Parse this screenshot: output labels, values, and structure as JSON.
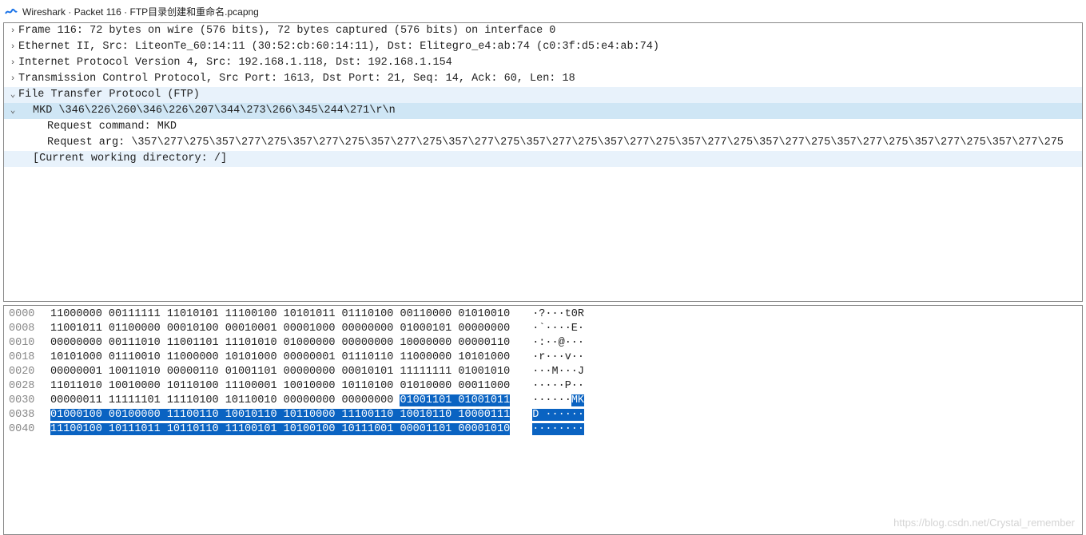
{
  "title": "Wireshark · Packet 116 · FTP目录创建和重命名.pcapng",
  "tree": [
    {
      "indent": 0,
      "toggle": ">",
      "text": "Frame 116: 72 bytes on wire (576 bits), 72 bytes captured (576 bits) on interface 0",
      "sel": ""
    },
    {
      "indent": 0,
      "toggle": ">",
      "text": "Ethernet II, Src: LiteonTe_60:14:11 (30:52:cb:60:14:11), Dst: Elitegro_e4:ab:74 (c0:3f:d5:e4:ab:74)",
      "sel": ""
    },
    {
      "indent": 0,
      "toggle": ">",
      "text": "Internet Protocol Version 4, Src: 192.168.1.118, Dst: 192.168.1.154",
      "sel": ""
    },
    {
      "indent": 0,
      "toggle": ">",
      "text": "Transmission Control Protocol, Src Port: 1613, Dst Port: 21, Seq: 14, Ack: 60, Len: 18",
      "sel": ""
    },
    {
      "indent": 0,
      "toggle": "v",
      "text": "File Transfer Protocol (FTP)",
      "sel": "light"
    },
    {
      "indent": 1,
      "toggle": "v",
      "text": "MKD \\346\\226\\260\\346\\226\\207\\344\\273\\266\\345\\244\\271\\r\\n",
      "sel": "mid"
    },
    {
      "indent": 2,
      "toggle": "",
      "text": "Request command: MKD",
      "sel": ""
    },
    {
      "indent": 2,
      "toggle": "",
      "text": "Request arg: \\357\\277\\275\\357\\277\\275\\357\\277\\275\\357\\277\\275\\357\\277\\275\\357\\277\\275\\357\\277\\275\\357\\277\\275\\357\\277\\275\\357\\277\\275\\357\\277\\275\\357\\277\\275",
      "sel": ""
    },
    {
      "indent": 1,
      "toggle": "",
      "text": "[Current working directory: /]",
      "sel": "light"
    }
  ],
  "hex": [
    {
      "off": "0000",
      "bytes": "11000000 00111111 11010101 11100100 10101011 01110100 00110000 01010010",
      "ascii": "·?···t0R",
      "hlStart": -1,
      "hlEnd": -1,
      "asciiHlStart": -1,
      "asciiHlEnd": -1
    },
    {
      "off": "0008",
      "bytes": "11001011 01100000 00010100 00010001 00001000 00000000 01000101 00000000",
      "ascii": "·`····E·",
      "hlStart": -1,
      "hlEnd": -1,
      "asciiHlStart": -1,
      "asciiHlEnd": -1
    },
    {
      "off": "0010",
      "bytes": "00000000 00111010 11001101 11101010 01000000 00000000 10000000 00000110",
      "ascii": "·:··@···",
      "hlStart": -1,
      "hlEnd": -1,
      "asciiHlStart": -1,
      "asciiHlEnd": -1
    },
    {
      "off": "0018",
      "bytes": "10101000 01110010 11000000 10101000 00000001 01110110 11000000 10101000",
      "ascii": "·r···v··",
      "hlStart": -1,
      "hlEnd": -1,
      "asciiHlStart": -1,
      "asciiHlEnd": -1
    },
    {
      "off": "0020",
      "bytes": "00000001 10011010 00000110 01001101 00000000 00010101 11111111 01001010",
      "ascii": "···M···J",
      "hlStart": -1,
      "hlEnd": -1,
      "asciiHlStart": -1,
      "asciiHlEnd": -1
    },
    {
      "off": "0028",
      "bytes": "11011010 10010000 10110100 11100001 10010000 10110100 01010000 00011000",
      "ascii": "·····P··",
      "hlStart": -1,
      "hlEnd": -1,
      "asciiHlStart": -1,
      "asciiHlEnd": -1
    },
    {
      "off": "0030",
      "bytes": "00000011 11111101 11110100 10110010 00000000 00000000 01001101 01001011",
      "ascii": "······MK",
      "hlStart": 54,
      "hlEnd": 71,
      "asciiHlStart": 6,
      "asciiHlEnd": 8
    },
    {
      "off": "0038",
      "bytes": "01000100 00100000 11100110 10010110 10110000 11100110 10010110 10000111",
      "ascii": "D ······",
      "hlStart": 0,
      "hlEnd": 71,
      "asciiHlStart": 0,
      "asciiHlEnd": 8
    },
    {
      "off": "0040",
      "bytes": "11100100 10111011 10110110 11100101 10100100 10111001 00001101 00001010",
      "ascii": "········",
      "hlStart": 0,
      "hlEnd": 71,
      "asciiHlStart": 0,
      "asciiHlEnd": 8
    }
  ],
  "watermark": "https://blog.csdn.net/Crystal_remember"
}
